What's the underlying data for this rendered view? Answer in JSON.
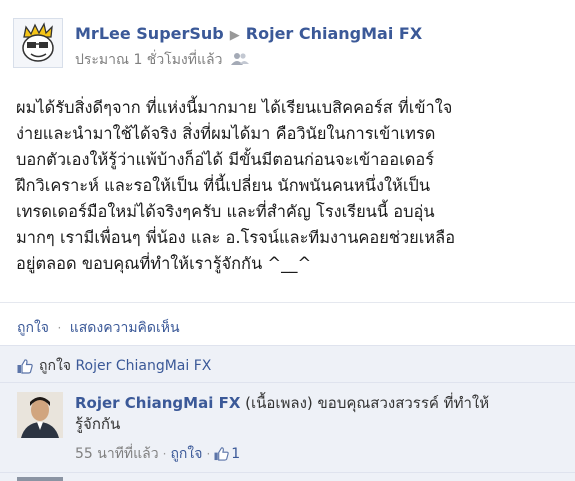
{
  "post": {
    "author": "MrLee SuperSub",
    "target": "Rojer ChiangMai FX",
    "timestamp": "ประมาณ 1 ชั่วโมงที่แล้ว",
    "privacy_icon": "people-icon",
    "avatar_icon": "cartoon-avatar-icon",
    "body": "ผมได้รับสิ่งดีๆจาก ที่แห่งนี้มากมาย ได้เรียนเบสิคคอร์ส ที่เข้าใจ\nง่ายและนำมาใช้ได้จริง สิ่งที่ผมได้มา คือวินัยในการเข้าเทรด\nบอกตัวเองให้รู้ว่าแพ้บ้างก็อ่ได้ มีขั้นมีตอนก่อนจะเข้าออเดอร์\nฝึกวิเคราะห์ และรอให้เป็น ที่นี้เปลี่ยน นักพนันคนหนึ่งให้เป็น\nเทรดเดอร์มือใหม่ได้จริงๆครับ และที่สำคัญ โรงเรียนนี้ อบอุ่น\nมากๆ เรามีเพื่อนๆ พี่น้อง และ อ.โรจน์และทีมงานคอยช่วยเหลือ\nอยู่ตลอด ขอบคุณที่ทำให้เรารู้จักกัน ^__^"
  },
  "actions": {
    "like": "ถูกใจ",
    "comment": "แสดงความคิดเห็น",
    "separator": "·"
  },
  "likes": {
    "icon": "thumbs-up-icon",
    "prefix": "ถูกใจ",
    "name": "Rojer ChiangMai FX"
  },
  "comment": {
    "author": "Rojer ChiangMai FX",
    "text": " (เนื้อเพลง) ขอบคุณสวงสวรรค์ ที่ทำให้รู้จักกัน",
    "time": "55 นาทีที่แล้ว",
    "like": "ถูกใจ",
    "like_count": "1",
    "like_icon": "thumbs-up-icon",
    "separator": "·"
  },
  "colors": {
    "link": "#3b5998",
    "meta": "#808080",
    "panel_bg": "#eef1f7"
  }
}
